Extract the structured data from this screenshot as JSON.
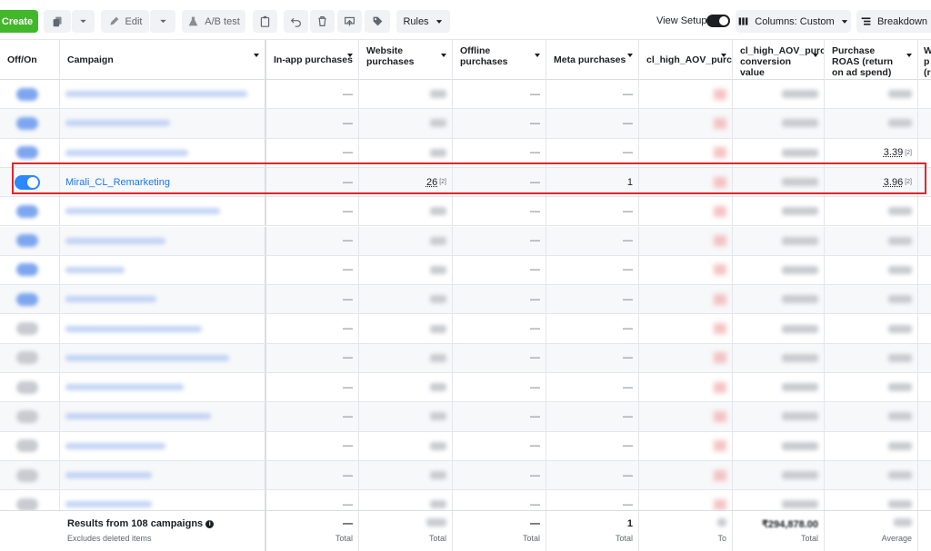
{
  "toolbar": {
    "create_label": "Create",
    "edit_label": "Edit",
    "ab_test_label": "A/B test",
    "rules_label": "Rules",
    "view_setup_label": "View Setup",
    "columns_label": "Columns: Custom",
    "breakdown_label": "Breakdown"
  },
  "columns": {
    "off_on": "Off/On",
    "campaign": "Campaign",
    "in_app": "In-app purchases",
    "website": "Website purchases",
    "offline": "Offline purchases",
    "meta": "Meta purchases",
    "cl_high": "cl_high_AOV_purc",
    "cl_high_value": "cl_high_AOV_purc conversion value",
    "roas": "Purchase ROAS (return on ad spend)",
    "next": "W p (r"
  },
  "rows": [
    {
      "in_app": "—",
      "website": "",
      "offline": "—",
      "meta": "—",
      "roas": "",
      "highlight": false
    },
    {
      "in_app": "—",
      "website": "",
      "offline": "—",
      "meta": "—",
      "roas": "",
      "highlight": false
    },
    {
      "in_app": "—",
      "website": "",
      "offline": "—",
      "meta": "—",
      "roas": "3.39",
      "highlight": false
    },
    {
      "campaign": "Mirali_CL_Remarketing",
      "in_app": "—",
      "website": "26",
      "offline": "—",
      "meta": "1",
      "roas": "3.96",
      "highlight": true
    },
    {
      "in_app": "—",
      "website": "",
      "offline": "—",
      "meta": "—",
      "roas": "",
      "highlight": false
    },
    {
      "in_app": "—",
      "website": "",
      "offline": "—",
      "meta": "—",
      "roas": "",
      "highlight": false
    },
    {
      "in_app": "—",
      "website": "",
      "offline": "—",
      "meta": "—",
      "roas": "",
      "highlight": false
    },
    {
      "in_app": "—",
      "website": "",
      "offline": "—",
      "meta": "—",
      "roas": "",
      "highlight": false
    },
    {
      "in_app": "—",
      "website": "",
      "offline": "—",
      "meta": "—",
      "roas": "",
      "highlight": false
    },
    {
      "in_app": "—",
      "website": "",
      "offline": "—",
      "meta": "—",
      "roas": "",
      "highlight": false
    },
    {
      "in_app": "—",
      "website": "",
      "offline": "—",
      "meta": "—",
      "roas": "",
      "highlight": false
    },
    {
      "in_app": "—",
      "website": "",
      "offline": "—",
      "meta": "—",
      "roas": "",
      "highlight": false
    },
    {
      "in_app": "—",
      "website": "",
      "offline": "—",
      "meta": "—",
      "roas": "",
      "highlight": false
    },
    {
      "in_app": "—",
      "website": "",
      "offline": "—",
      "meta": "—",
      "roas": "",
      "highlight": false
    },
    {
      "in_app": "—",
      "website": "",
      "offline": "—",
      "meta": "—",
      "roas": "",
      "highlight": false
    }
  ],
  "footer": {
    "results": "Results from 108 campaigns",
    "excludes": "Excludes deleted items",
    "in_app_value": "—",
    "offline_value": "—",
    "meta_value": "1",
    "cl_high_value_total": "₹294,878.00",
    "total_label": "Total",
    "average_label": "Average"
  },
  "sup_mark": "[2]"
}
